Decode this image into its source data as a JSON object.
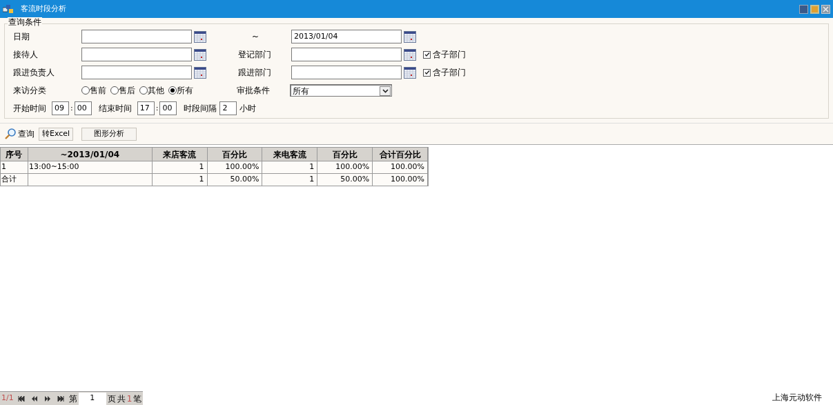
{
  "window": {
    "title": "客流时段分析"
  },
  "query": {
    "legend": "查询条件",
    "date_from": {
      "label": "日期"
    },
    "date_sep": "~",
    "date_to": {
      "value": "2013/01/04"
    },
    "receptionist": {
      "label": "接待人"
    },
    "register_dept": {
      "label": "登记部门",
      "include_sub": {
        "label": "含子部门",
        "checked": true
      }
    },
    "follow_owner": {
      "label": "跟进负责人"
    },
    "follow_dept": {
      "label": "跟进部门",
      "include_sub": {
        "label": "含子部门",
        "checked": true
      }
    },
    "visit_type": {
      "label": "来访分类",
      "options": [
        {
          "label": "售前",
          "selected": false
        },
        {
          "label": "售后",
          "selected": false
        },
        {
          "label": "其他",
          "selected": false
        },
        {
          "label": "所有",
          "selected": true
        }
      ]
    },
    "approval": {
      "label": "审批条件",
      "value": "所有"
    },
    "start_time": {
      "label": "开始时间",
      "hour": "09",
      "sep": ":",
      "minute": "00"
    },
    "end_time": {
      "label": "结束时间",
      "hour": "17",
      "sep": ":",
      "minute": "00"
    },
    "interval": {
      "label": "时段间隔",
      "value": "2",
      "unit": "小时"
    }
  },
  "toolbar": [
    {
      "kind": "search",
      "label": "查询"
    },
    {
      "kind": "button",
      "label": "转Excel"
    },
    {
      "kind": "button",
      "label": "图形分析"
    }
  ],
  "table": {
    "columns": [
      "序号",
      "~2013/01/04",
      "来店客流",
      "百分比",
      "来电客流",
      "百分比",
      "合计百分比"
    ],
    "rows": [
      [
        "1",
        "13:00~15:00",
        "1",
        "100.00%",
        "1",
        "100.00%",
        "100.00%"
      ],
      [
        "合计",
        "",
        "1",
        "50.00%",
        "1",
        "50.00%",
        "100.00%"
      ]
    ]
  },
  "pager": {
    "page_info": "1/1",
    "page_prefix": "第",
    "page": "1",
    "page_suffix": "页",
    "total_prefix": "共",
    "total": "1",
    "total_suffix": "笔"
  },
  "status": "上海元动软件"
}
